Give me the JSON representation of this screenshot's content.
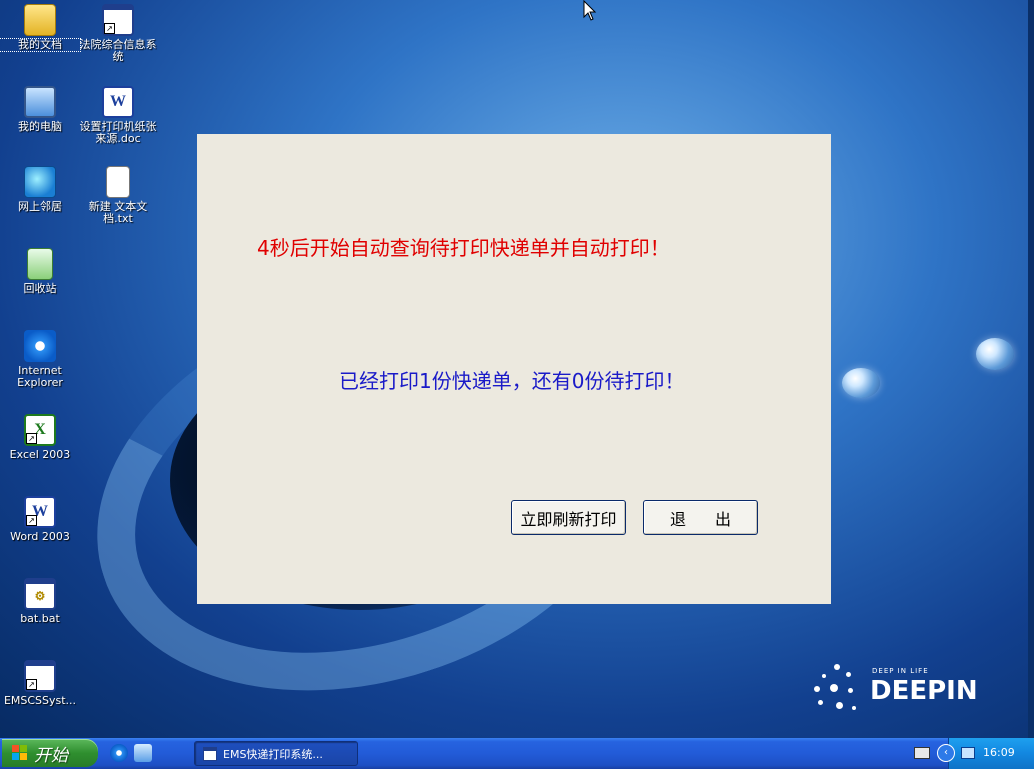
{
  "desktop": {
    "icons": [
      {
        "label": "我的文档",
        "icon": "folder-icon"
      },
      {
        "label": "法院综合信息系统",
        "icon": "shortcut-window-icon"
      },
      {
        "label": "我的电脑",
        "icon": "computer-icon"
      },
      {
        "label": "设置打印机纸张来源.doc",
        "icon": "word-doc-icon"
      },
      {
        "label": "网上邻居",
        "icon": "network-icon"
      },
      {
        "label": "新建 文本文档.txt",
        "icon": "text-file-icon"
      },
      {
        "label": "回收站",
        "icon": "recycle-bin-icon"
      },
      {
        "label": "Internet Explorer",
        "icon": "internet-explorer-icon"
      },
      {
        "label": "Excel 2003",
        "icon": "excel-icon"
      },
      {
        "label": "Word 2003",
        "icon": "word-icon"
      },
      {
        "label": "bat.bat",
        "icon": "batch-file-icon"
      },
      {
        "label": "EMSCSSyst...",
        "icon": "shortcut-window-icon"
      }
    ]
  },
  "dialog": {
    "countdown_message": "4秒后开始自动查询待打印快递单并自动打印！",
    "status_message": "已经打印1份快递单，还有0份待打印！",
    "refresh_button": "立即刷新打印",
    "exit_button": "退 出"
  },
  "wallpaper": {
    "tagline": "DEEP IN LIFE",
    "brand": "DEEPIN"
  },
  "taskbar": {
    "start_label": "开始",
    "task_label": "EMS快递打印系统...",
    "clock": "16:09"
  },
  "colors": {
    "countdown_text": "#e00000",
    "status_text": "#1a1ac8",
    "dialog_bg": "#ece9df"
  }
}
